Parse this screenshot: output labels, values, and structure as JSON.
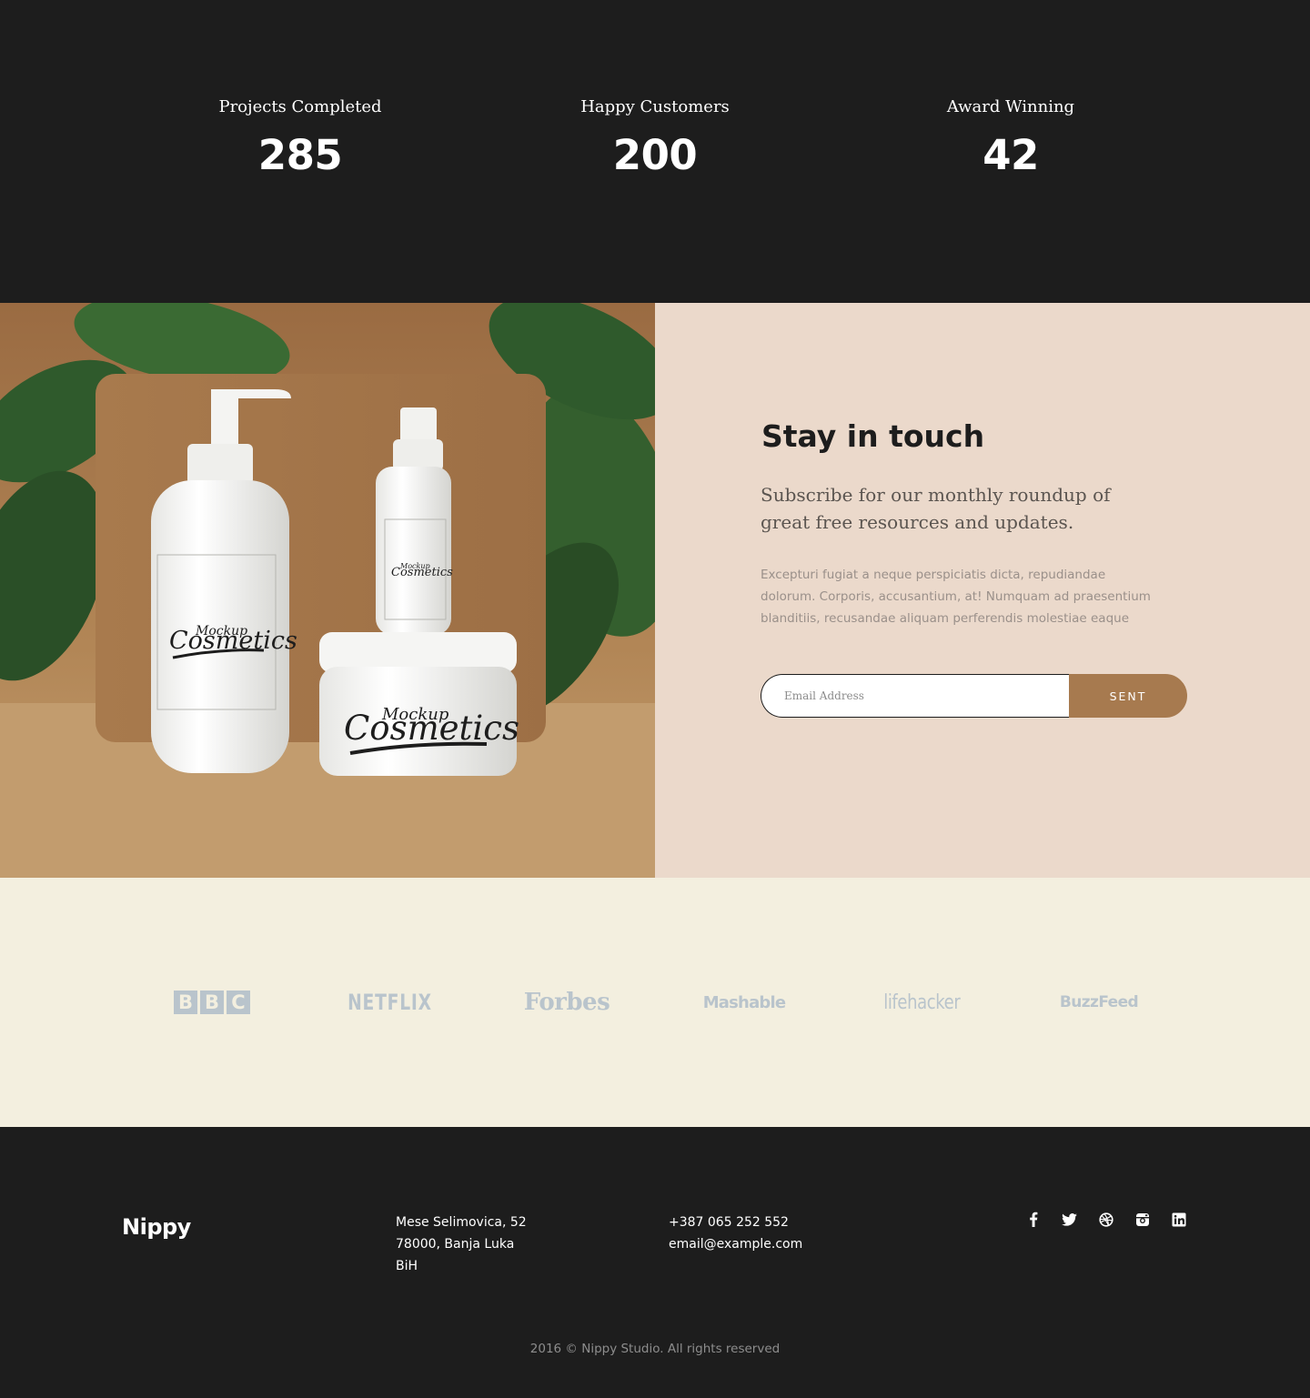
{
  "stats": [
    {
      "label": "Projects Completed",
      "value": "285"
    },
    {
      "label": "Happy Customers",
      "value": "200"
    },
    {
      "label": "Award Winning",
      "value": "42"
    }
  ],
  "newsletter": {
    "title": "Stay in touch",
    "subtitle": "Subscribe for our monthly roundup of great free resources and updates.",
    "body": "Excepturi fugiat a neque perspiciatis dicta, repudiandae dolorum. Corporis, accusantium, at! Numquam ad praesentium blanditiis, recusandae aliquam perferendis molestiae eaque",
    "email_placeholder": "Email Address",
    "button_label": "SENT",
    "product_label_small": "Mockup",
    "product_label_big": "Cosmetics"
  },
  "press": {
    "logos": [
      {
        "name": "bbc",
        "letters": [
          "B",
          "B",
          "C"
        ]
      },
      {
        "name": "netflix",
        "text": "NETFLIX"
      },
      {
        "name": "forbes",
        "text": "Forbes"
      },
      {
        "name": "mashable",
        "text": "Mashable"
      },
      {
        "name": "lifehacker",
        "text_a": "life",
        "text_b": "hacker"
      },
      {
        "name": "buzzfeed",
        "text": "BuzzFeed"
      }
    ]
  },
  "footer": {
    "brand": "Nippy",
    "address": [
      "Mese Selimovica, 52",
      "78000, Banja Luka",
      "BiH"
    ],
    "phone": "+387 065 252 552",
    "email": "email@example.com",
    "socials": [
      "facebook-icon",
      "twitter-icon",
      "dribbble-icon",
      "instagram-icon",
      "linkedin-icon"
    ],
    "copyright": "2016 © Nippy Studio. All rights reserved"
  },
  "colors": {
    "dark": "#1d1d1d",
    "accent": "#a77a4f",
    "newsletter_bg": "#ebd9cb",
    "press_bg": "#f3efdf",
    "logo_grey": "#b9c4cc"
  }
}
